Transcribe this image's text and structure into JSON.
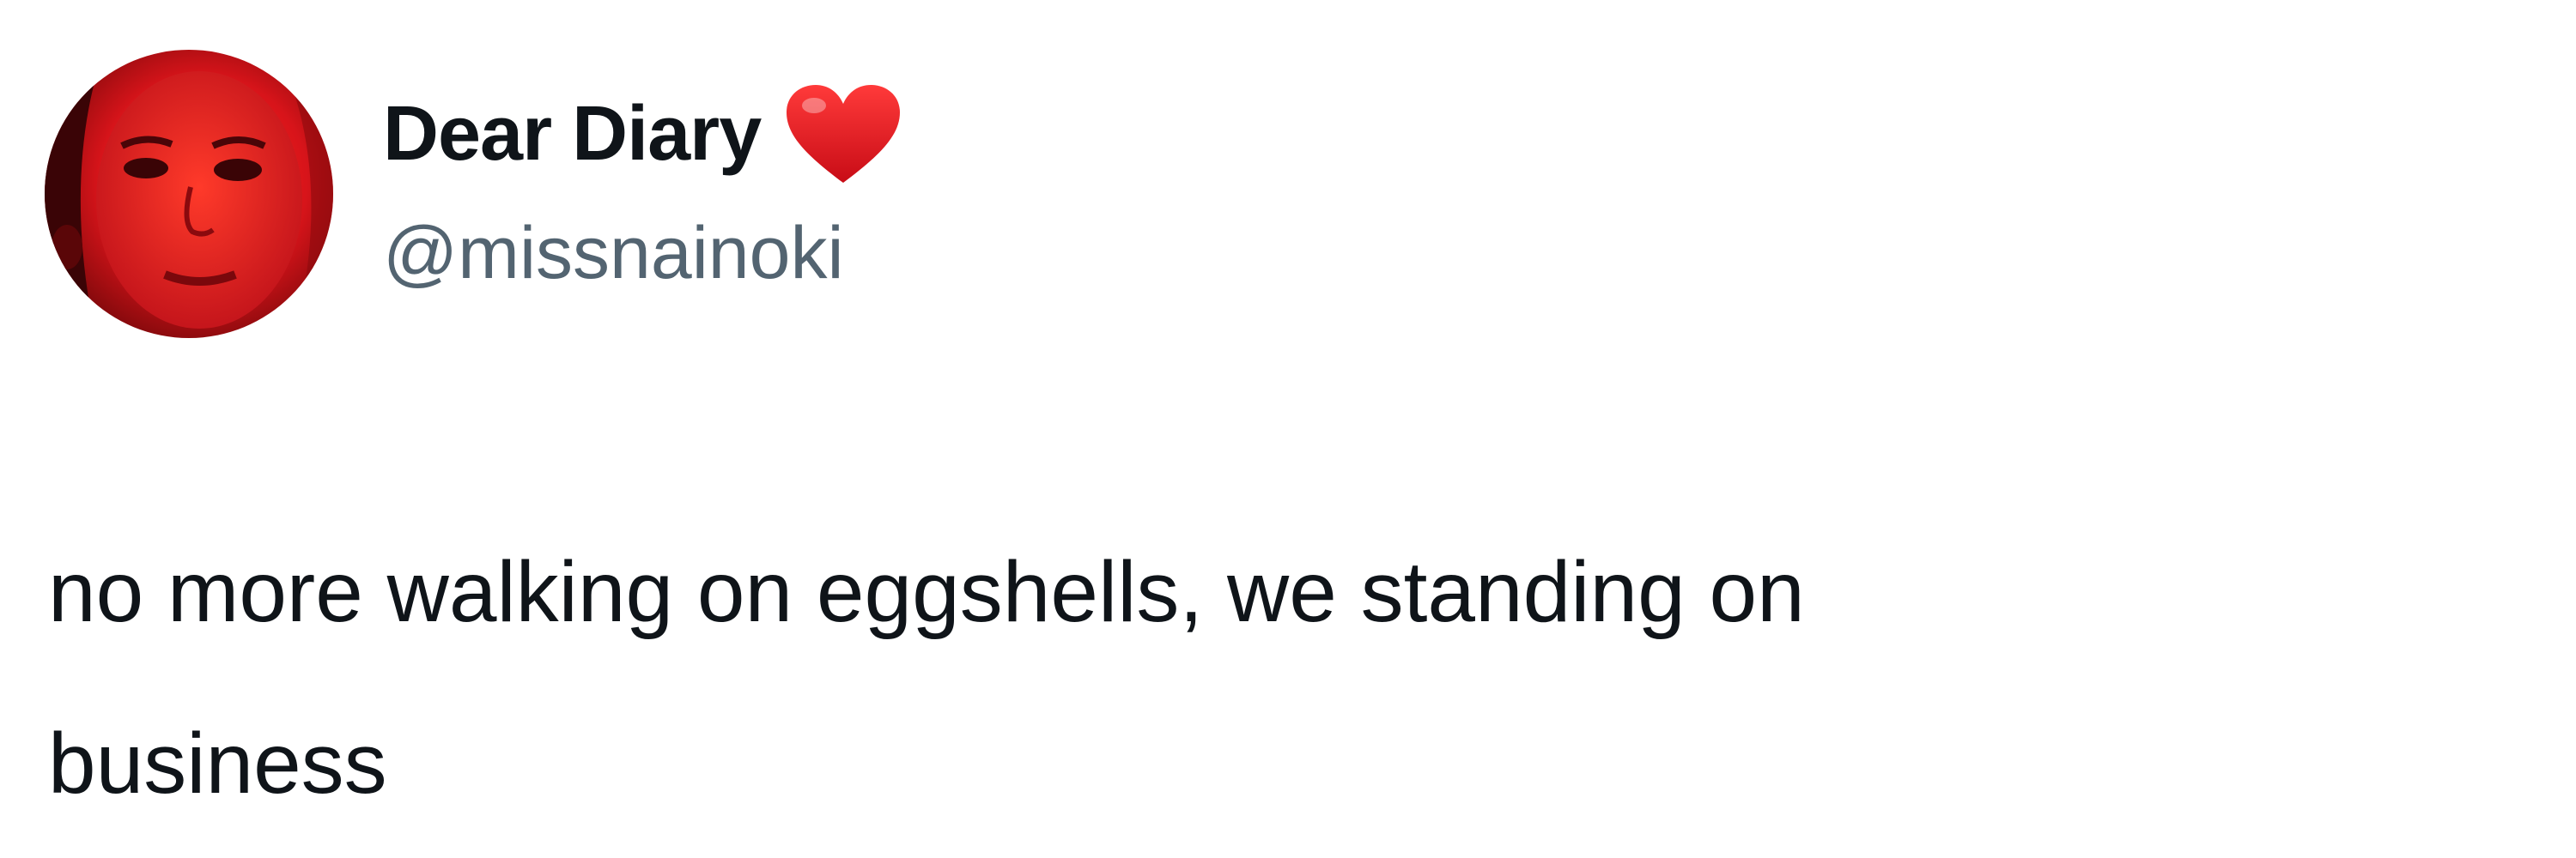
{
  "tweet": {
    "author": {
      "display_name": "Dear Diary",
      "name_emoji": "heart-icon",
      "handle": "@missnainoki",
      "avatar": "avatar-photo"
    },
    "text_lines": [
      "no more walking on eggshells, we standing on",
      "business"
    ]
  },
  "colors": {
    "text_primary": "#0f1419",
    "text_secondary": "#536471",
    "heart": "#e0121c",
    "avatar_tone": "#d0141c"
  }
}
